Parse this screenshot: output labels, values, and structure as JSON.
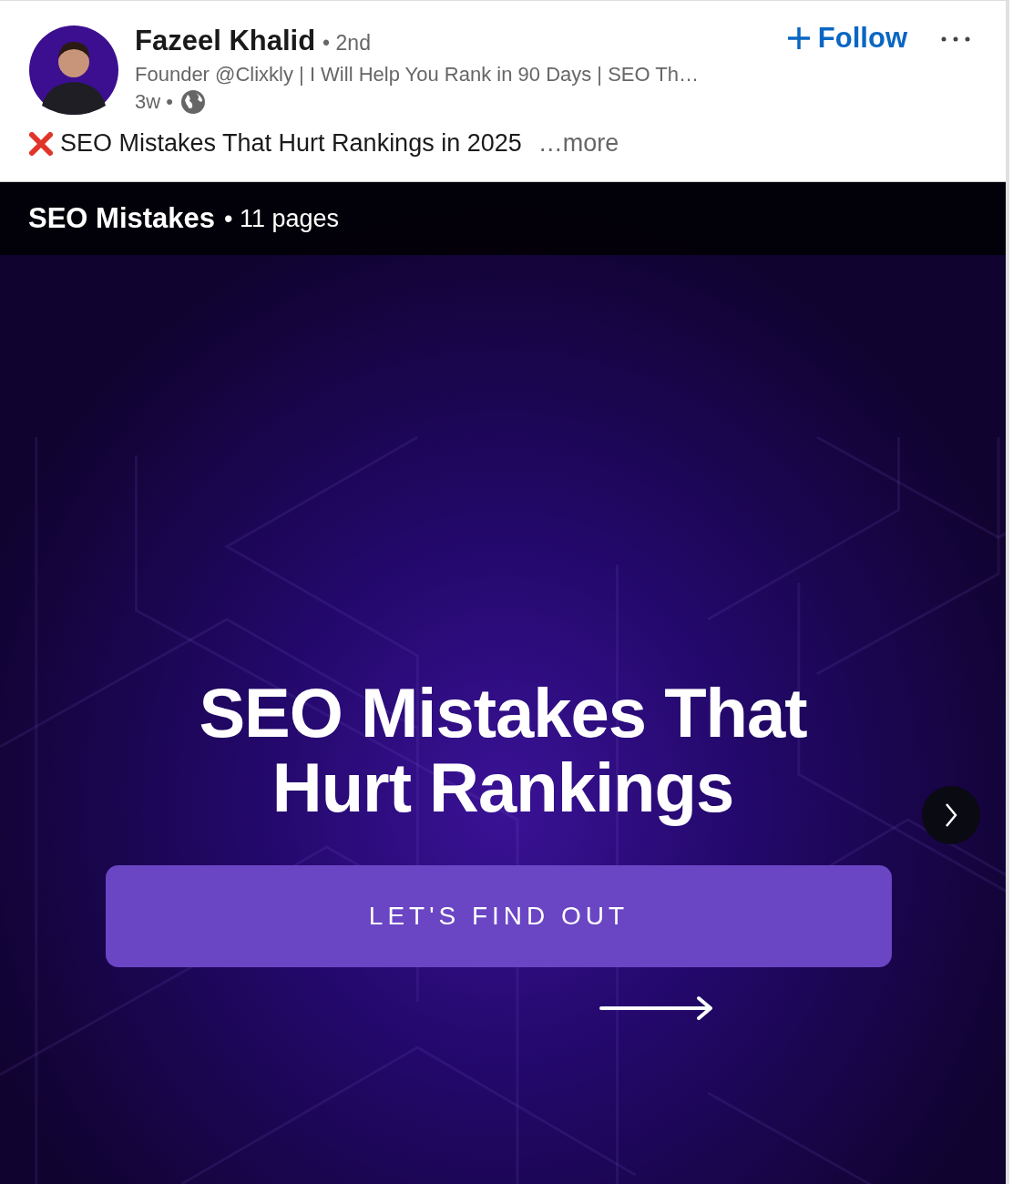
{
  "author": {
    "name": "Fazeel Khalid",
    "degree": "• 2nd",
    "headline": "Founder @Clixkly | I Will Help You Rank in 90 Days | SEO Th…",
    "time": "3w •"
  },
  "follow_button": {
    "label": "Follow"
  },
  "post": {
    "text": "SEO Mistakes That Hurt Rankings in 2025",
    "more_link": "…more"
  },
  "document": {
    "title": "SEO Mistakes",
    "pages": "• 11 pages",
    "slide": {
      "title_lines": [
        "SEO Mistakes That",
        "Hurt Rankings"
      ],
      "button": "LET'S FIND OUT"
    }
  }
}
